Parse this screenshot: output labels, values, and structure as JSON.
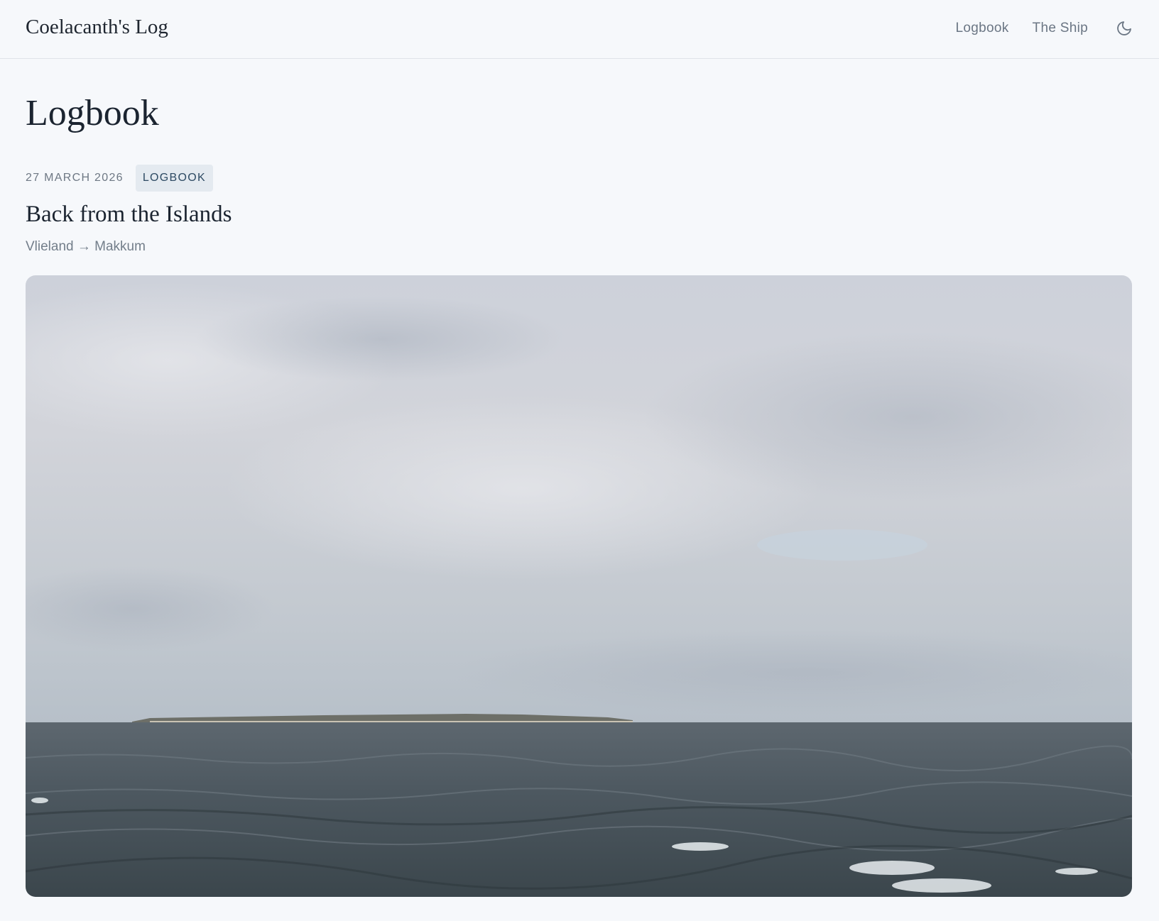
{
  "header": {
    "site_title": "Coelacanth's Log",
    "nav": [
      {
        "label": "Logbook"
      },
      {
        "label": "The Ship"
      }
    ],
    "theme_toggle_icon": "moon-icon"
  },
  "page": {
    "title": "Logbook"
  },
  "post": {
    "date": "27 MARCH 2026",
    "tag": "LOGBOOK",
    "title": "Back from the Islands",
    "route": "Vlieland → Makkum",
    "image_subject": "overcast sky over choppy grey sea with low island on horizon"
  },
  "colors": {
    "background": "#f6f8fb",
    "text": "#1b2430",
    "muted": "#6e7884",
    "tag_bg": "#e4eaf0",
    "tag_text": "#2d4a63"
  }
}
